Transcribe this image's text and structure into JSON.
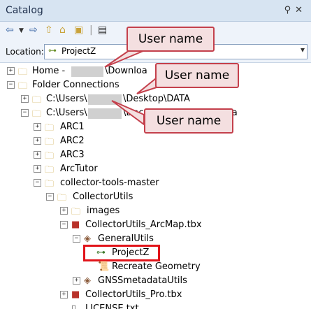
{
  "window": {
    "title": "Catalog",
    "controls": [
      "pin-icon",
      "close-icon"
    ]
  },
  "toolbar": {
    "tools": [
      "back-icon",
      "dropdown-icon",
      "forward-icon",
      "up-icon",
      "home-icon",
      "connect-folder-icon",
      "view-icon"
    ]
  },
  "location": {
    "label": "Location:",
    "value": "ProjectZ"
  },
  "tree": {
    "items": [
      {
        "label_pre": "Home - ",
        "label_post": "\\Downloa",
        "icon": "home-folder-icon",
        "expander": "+"
      },
      {
        "label": "Folder Connections",
        "icon": "folder-connections-icon",
        "expander": "−"
      },
      {
        "label_pre": "C:\\Users\\",
        "label_post": "\\Desktop\\DATA",
        "icon": "folder-connection-icon",
        "expander": "+"
      },
      {
        "label_pre": "C:\\Users\\",
        "label_post": "\\Documents\\Testing Data",
        "icon": "folder-connection-icon",
        "expander": "−"
      },
      {
        "label": "ARC1",
        "icon": "folder-icon",
        "expander": "+"
      },
      {
        "label": "ARC2",
        "icon": "folder-icon",
        "expander": "+"
      },
      {
        "label": "ARC3",
        "icon": "folder-icon",
        "expander": "+"
      },
      {
        "label": "ArcTutor",
        "icon": "folder-icon",
        "expander": "+"
      },
      {
        "label": "collector-tools-master",
        "icon": "folder-icon",
        "expander": "−"
      },
      {
        "label": "CollectorUtils",
        "icon": "folder-icon",
        "expander": "−"
      },
      {
        "label": "images",
        "icon": "folder-icon",
        "expander": "+"
      },
      {
        "label": "CollectorUtils_ArcMap.tbx",
        "icon": "toolbox-icon",
        "expander": "−"
      },
      {
        "label": "GeneralUtils",
        "icon": "toolset-icon",
        "expander": "−"
      },
      {
        "label": "ProjectZ",
        "icon": "model-icon",
        "expander": ""
      },
      {
        "label": "Recreate Geometry",
        "icon": "script-icon",
        "expander": ""
      },
      {
        "label": "GNSSmetadataUtils",
        "icon": "toolset-icon",
        "expander": "+"
      },
      {
        "label": "CollectorUtils_Pro.tbx",
        "icon": "toolbox-icon",
        "expander": "+"
      },
      {
        "label": "LICENSE.txt",
        "icon": "text-file-icon",
        "expander": ""
      }
    ]
  },
  "callouts": [
    {
      "text": "User name"
    },
    {
      "text": "User name"
    },
    {
      "text": "User name"
    }
  ]
}
